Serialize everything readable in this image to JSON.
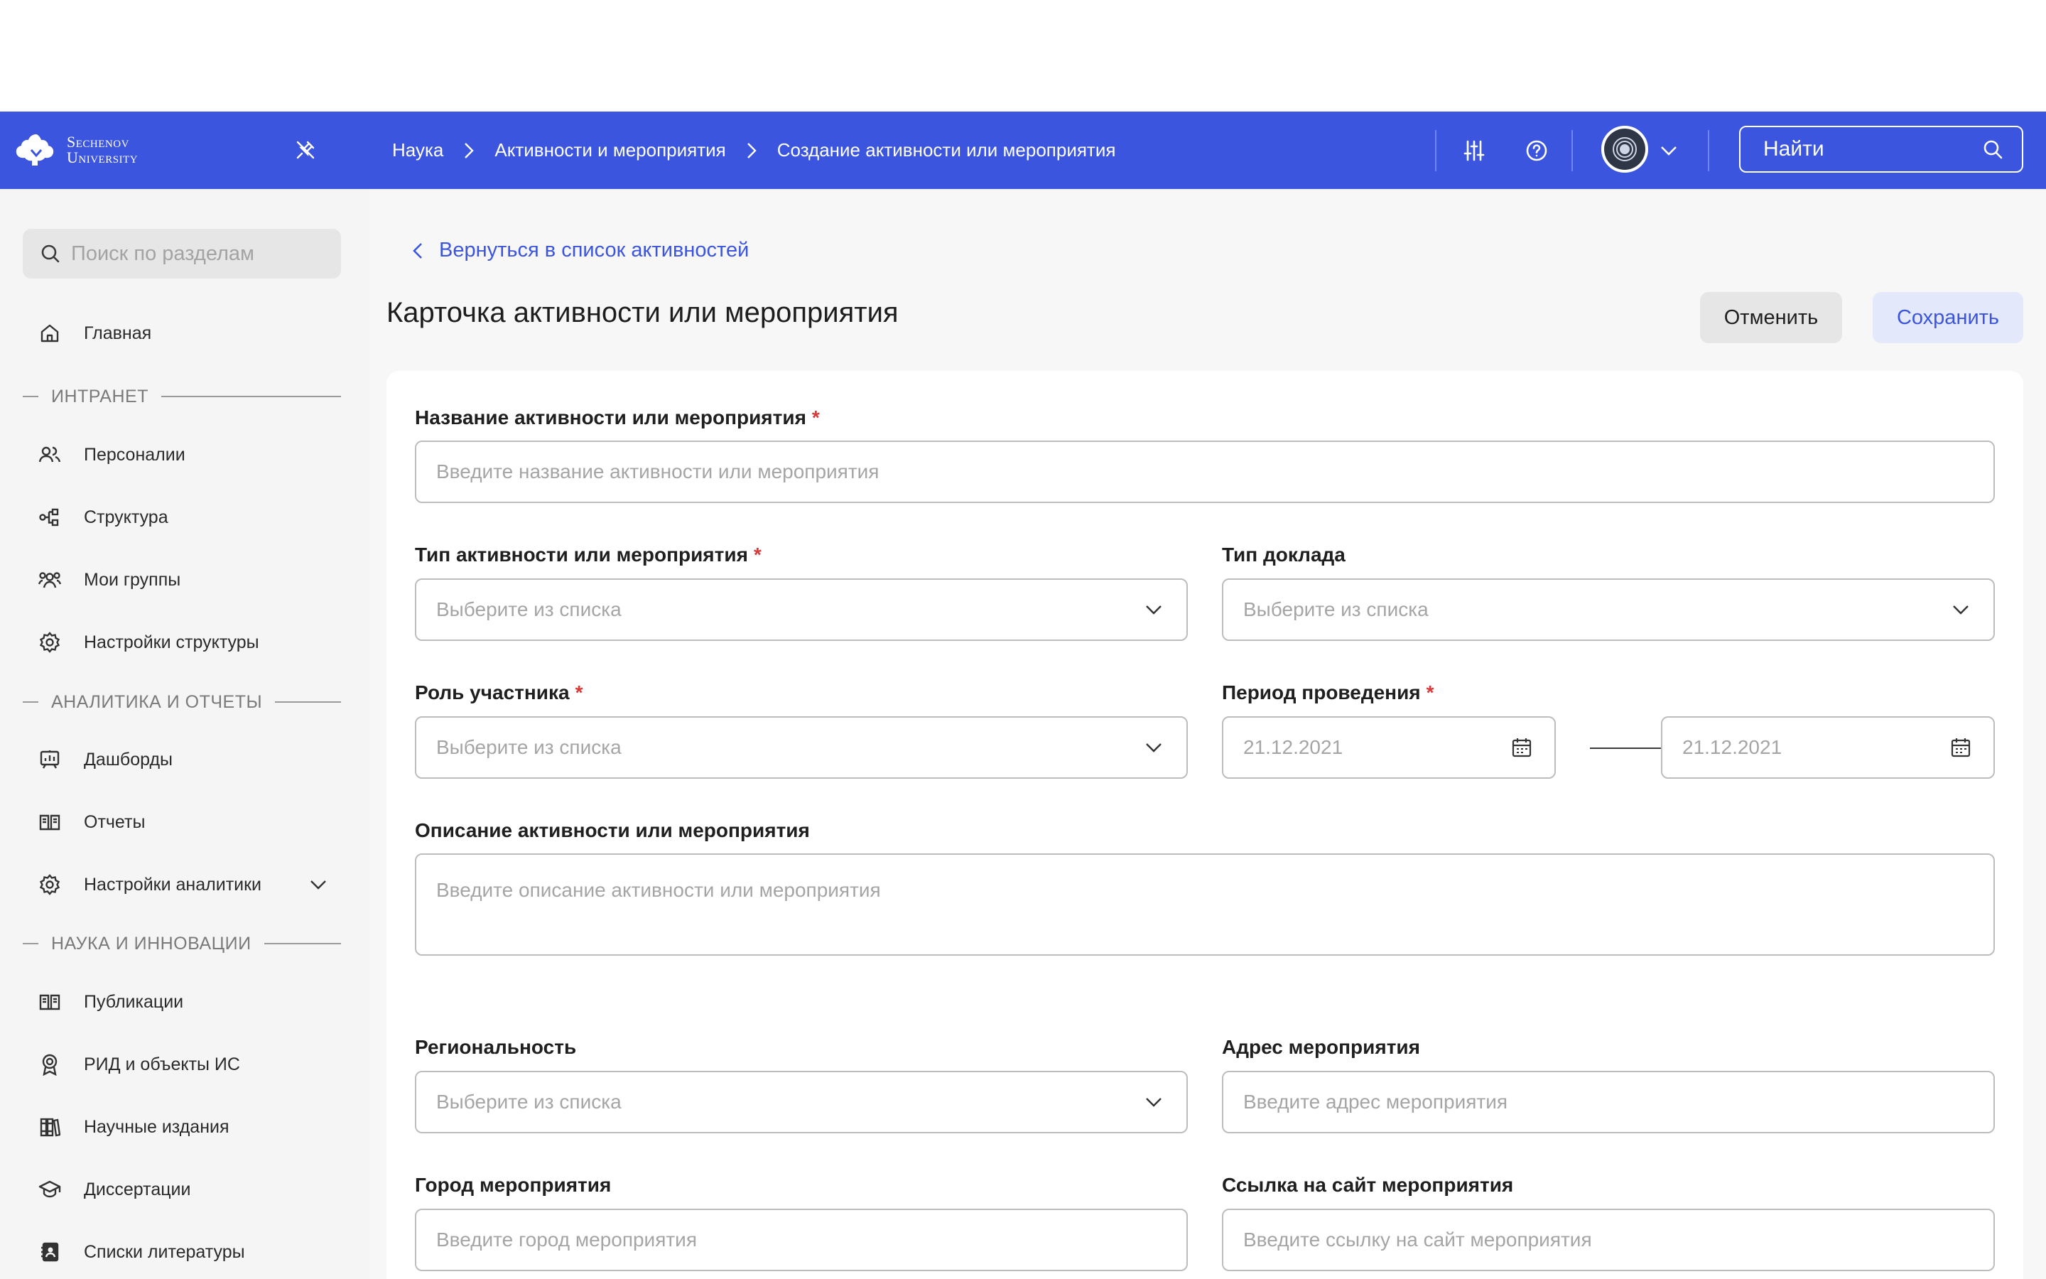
{
  "logo": {
    "line1": "Sechenov",
    "line2": "University"
  },
  "breadcrumbs": [
    "Наука",
    "Активности и мероприятия",
    "Создание активности или мероприятия"
  ],
  "top_search": {
    "placeholder": "Найти"
  },
  "sidebar": {
    "search_placeholder": "Поиск по разделам",
    "home": "Главная",
    "sections": [
      {
        "title": "ИНТРАНЕТ",
        "items": [
          "Персоналии",
          "Структура",
          "Мои группы",
          "Настройки структуры"
        ]
      },
      {
        "title": "АНАЛИТИКА И ОТЧЕТЫ",
        "items": [
          "Дашборды",
          "Отчеты",
          "Настройки аналитики"
        ]
      },
      {
        "title": "НАУКА И ИННОВАЦИИ",
        "items": [
          "Публикации",
          "РИД и объекты ИС",
          "Научные издания",
          "Диссертации",
          "Списки литературы"
        ]
      }
    ]
  },
  "main": {
    "back_link": "Вернуться в список активностей",
    "title": "Карточка активности или мероприятия",
    "cancel": "Отменить",
    "save": "Сохранить"
  },
  "form": {
    "name": {
      "label": "Название активности или мероприятия",
      "placeholder": "Введите название активности или мероприятия"
    },
    "activity_type": {
      "label": "Тип активности или мероприятия",
      "placeholder": "Выберите из списка"
    },
    "report_type": {
      "label": "Тип доклада",
      "placeholder": "Выберите из списка"
    },
    "role": {
      "label": "Роль участника",
      "placeholder": "Выберите из списка"
    },
    "period": {
      "label": "Период проведения",
      "from": "21.12.2021",
      "to": "21.12.2021"
    },
    "description": {
      "label": "Описание активности или мероприятия",
      "placeholder": "Введите описание активности или мероприятия"
    },
    "regionality": {
      "label": "Региональность",
      "placeholder": "Выберите из списка"
    },
    "address": {
      "label": "Адрес мероприятия",
      "placeholder": "Введите адрес мероприятия"
    },
    "city": {
      "label": "Город мероприятия",
      "placeholder": "Введите город мероприятия"
    },
    "website": {
      "label": "Ссылка на сайт мероприятия",
      "placeholder": "Введите ссылку на сайт мероприятия"
    },
    "required_mark": "*"
  },
  "colors": {
    "brand": "#3b55de",
    "required": "#d83a3a"
  }
}
